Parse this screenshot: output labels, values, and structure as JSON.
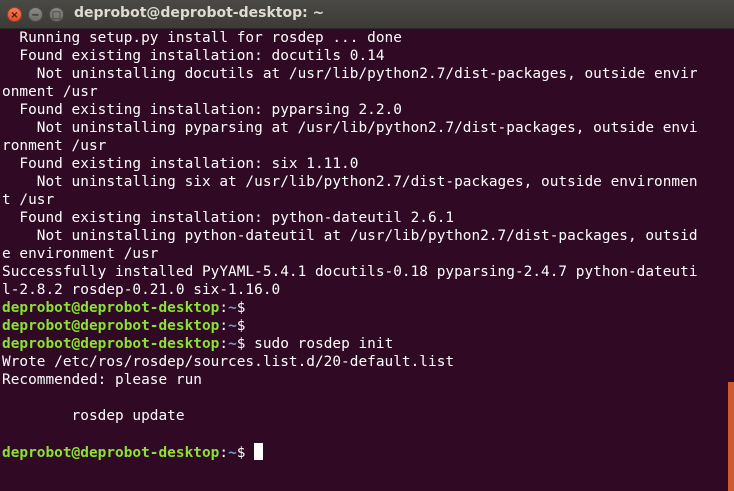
{
  "window": {
    "title": "deprobot@deprobot-desktop: ~",
    "controls": {
      "close": "×",
      "minimize": "−",
      "maximize": "□"
    }
  },
  "colors": {
    "background": "#300a24",
    "prompt_user": "#8ae234",
    "prompt_path": "#729fcf",
    "text": "#ffffff",
    "scrollbar": "#d15a2b"
  },
  "terminal": {
    "output_lines": [
      "  Running setup.py install for rosdep ... done",
      "  Found existing installation: docutils 0.14",
      "    Not uninstalling docutils at /usr/lib/python2.7/dist-packages, outside envir",
      "onment /usr",
      "  Found existing installation: pyparsing 2.2.0",
      "    Not uninstalling pyparsing at /usr/lib/python2.7/dist-packages, outside envi",
      "ronment /usr",
      "  Found existing installation: six 1.11.0",
      "    Not uninstalling six at /usr/lib/python2.7/dist-packages, outside environmen",
      "t /usr",
      "  Found existing installation: python-dateutil 2.6.1",
      "    Not uninstalling python-dateutil at /usr/lib/python2.7/dist-packages, outsid",
      "e environment /usr",
      "Successfully installed PyYAML-5.4.1 docutils-0.18 pyparsing-2.4.7 python-dateuti",
      "l-2.8.2 rosdep-0.21.0 six-1.16.0"
    ],
    "prompt_user_host": "deprobot@deprobot-desktop",
    "prompt_separator": ":",
    "prompt_path": "~",
    "prompt_symbol": "$",
    "prompts": [
      {
        "command": ""
      },
      {
        "command": ""
      },
      {
        "command": " sudo rosdep init"
      }
    ],
    "after_lines": [
      "Wrote /etc/ros/rosdep/sources.list.d/20-default.list",
      "Recommended: please run",
      "",
      "        rosdep update",
      ""
    ],
    "final_prompt_command": " "
  }
}
